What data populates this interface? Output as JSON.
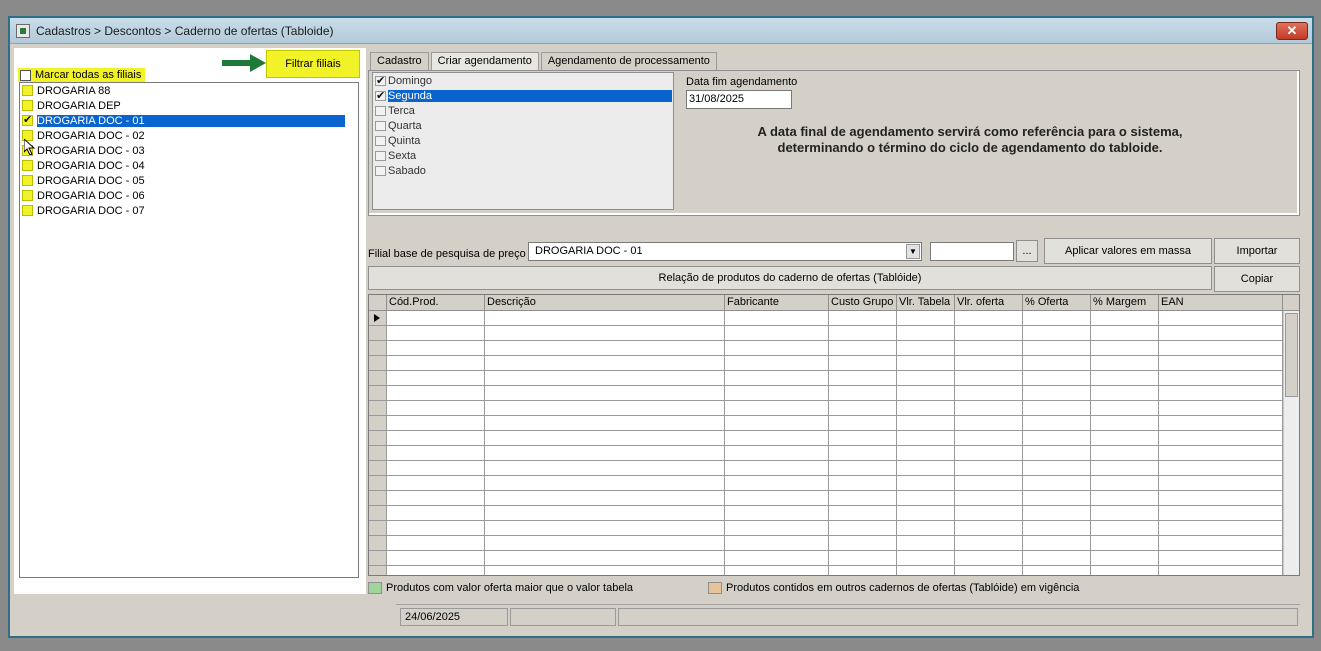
{
  "window": {
    "title": "Cadastros > Descontos > Caderno de ofertas (Tabloide)",
    "close_label": "✕"
  },
  "left": {
    "filtrar_label": "Filtrar filiais",
    "marcar_todas_label": "Marcar todas as filiais",
    "filiais": [
      {
        "label": "DROGARIA 88",
        "checked": false,
        "selected": false
      },
      {
        "label": "DROGARIA DEP",
        "checked": false,
        "selected": false
      },
      {
        "label": "DROGARIA DOC - 01",
        "checked": true,
        "selected": true
      },
      {
        "label": "DROGARIA DOC - 02",
        "checked": false,
        "selected": false
      },
      {
        "label": "DROGARIA DOC - 03",
        "checked": false,
        "selected": false
      },
      {
        "label": "DROGARIA DOC - 04",
        "checked": false,
        "selected": false
      },
      {
        "label": "DROGARIA DOC - 05",
        "checked": false,
        "selected": false
      },
      {
        "label": "DROGARIA DOC - 06",
        "checked": false,
        "selected": false
      },
      {
        "label": "DROGARIA DOC - 07",
        "checked": false,
        "selected": false
      }
    ]
  },
  "tabs": [
    {
      "label": "Cadastro",
      "active": false
    },
    {
      "label": "Criar agendamento",
      "active": true
    },
    {
      "label": "Agendamento de processamento",
      "active": false
    }
  ],
  "schedule": {
    "days": [
      {
        "label": "Domingo",
        "checked": true,
        "selected": false
      },
      {
        "label": "Segunda",
        "checked": true,
        "selected": true
      },
      {
        "label": "Terca",
        "checked": false,
        "selected": false
      },
      {
        "label": "Quarta",
        "checked": false,
        "selected": false
      },
      {
        "label": "Quinta",
        "checked": false,
        "selected": false
      },
      {
        "label": "Sexta",
        "checked": false,
        "selected": false
      },
      {
        "label": "Sabado",
        "checked": false,
        "selected": false
      }
    ],
    "data_fim_label": "Data fim agendamento",
    "data_fim_value": "31/08/2025",
    "info_line1": "A data final de agendamento servirá como referência para o sistema,",
    "info_line2": "determinando o término do ciclo de agendamento do tabloide."
  },
  "filial_base": {
    "label": "Filial base de pesquisa de preço",
    "value": "DROGARIA DOC - 01",
    "ellipsis": "...",
    "aplicar_label": "Aplicar valores em massa",
    "importar_label": "Importar",
    "copiar_label": "Copiar",
    "relacao_label": "Relação de produtos do caderno de ofertas (Tablóide)"
  },
  "grid": {
    "columns": [
      "Cód.Prod.",
      "Descrição",
      "Fabricante",
      "Custo Grupo",
      "Vlr. Tabela",
      "Vlr. oferta",
      "% Oferta",
      "% Margem",
      "EAN"
    ],
    "row_count": 18
  },
  "legend": {
    "item1_label": "Produtos com valor oferta maior que o valor tabela",
    "item1_color": "#9ed69a",
    "item2_label": "Produtos contidos em outros cadernos de ofertas (Tablóide) em vigência",
    "item2_color": "#e8c39a"
  },
  "status": {
    "date": "24/06/2025"
  },
  "colors": {
    "highlight_yellow": "#f2f228",
    "selection_blue": "#0a64d0",
    "arrow_green": "#1f7a3a"
  }
}
